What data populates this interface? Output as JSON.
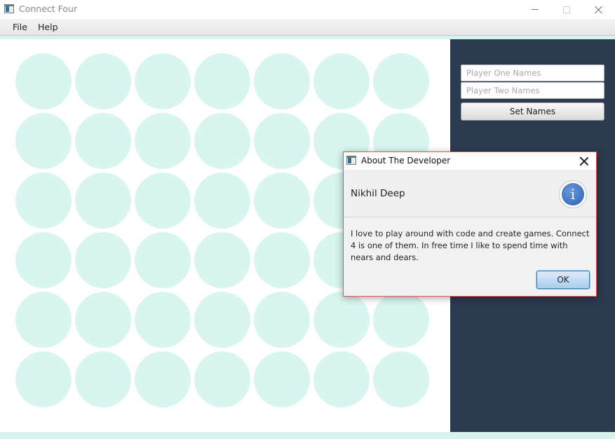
{
  "window": {
    "title": "Connect Four"
  },
  "menu": {
    "items": [
      {
        "label": "File"
      },
      {
        "label": "Help"
      }
    ]
  },
  "board": {
    "rows": 6,
    "columns": 7,
    "empty_slot_color": "#d8f5ef"
  },
  "side_panel": {
    "background": "#2c3a4f",
    "player_one_placeholder": "Player One Names",
    "player_two_placeholder": "Player Two Names",
    "set_names_label": "Set Names"
  },
  "dialog": {
    "title": "About The Developer",
    "header": "Nikhil Deep",
    "icon": "info-icon",
    "body": "I love to play around with code and create games. Connect 4 is one of them. In free time I like to spend time with nears and dears.",
    "ok_label": "OK"
  }
}
